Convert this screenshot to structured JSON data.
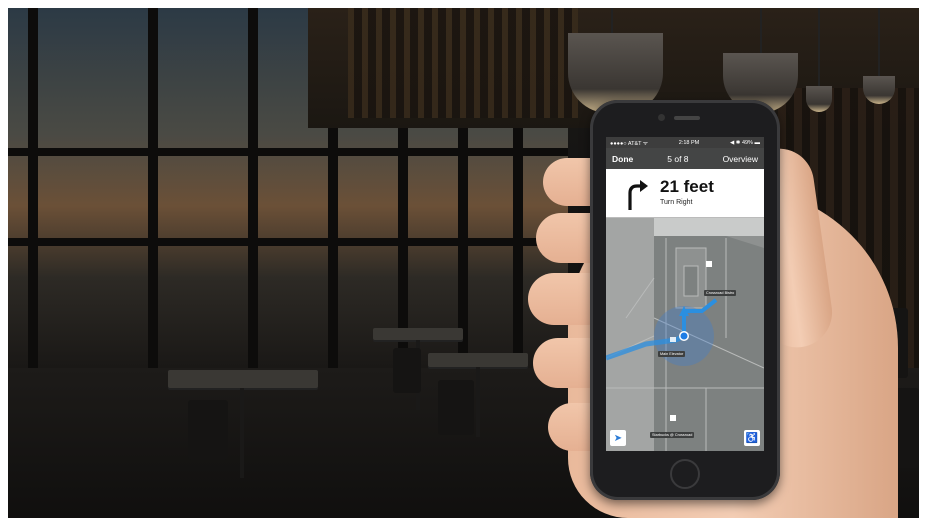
{
  "status_bar": {
    "carrier": "●●●●○ AT&T ᯤ",
    "time": "2:18 PM",
    "battery": "◀ ✱ 49% ▬"
  },
  "nav": {
    "done_label": "Done",
    "step": "5 of 8",
    "overview_label": "Overview"
  },
  "direction": {
    "distance": "21 feet",
    "instruction": "Turn Right"
  },
  "map": {
    "labels": {
      "upper_store": "Crossroad Bistro",
      "elevator": "Main Elevator",
      "bottom_store": "Starbucks @ Crossroad"
    }
  },
  "icons": {
    "turn": "turn-right-arrow-icon",
    "locate": "location-arrow-icon",
    "accessibility": "wheelchair-icon"
  },
  "colors": {
    "route": "#2b8fe0",
    "nav_bar": "#444545",
    "map_bg": "#8e9190"
  }
}
